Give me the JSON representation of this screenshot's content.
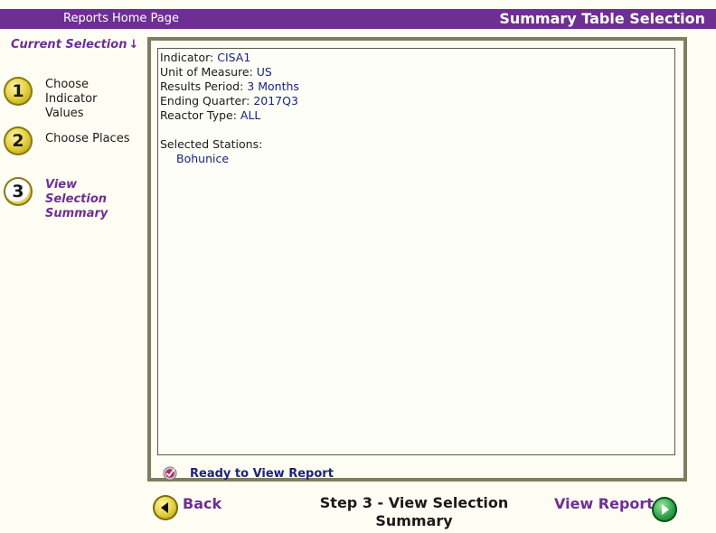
{
  "header": {
    "home_link": "Reports Home Page",
    "title": "Summary Table Selection"
  },
  "sidebar": {
    "current_selection_label": "Current Selection",
    "current_selection_icon": "arrow-down-icon",
    "steps": [
      {
        "number": "1",
        "label_lines": [
          "Choose",
          "Indicator",
          "Values"
        ],
        "label": "Choose Indicator Values",
        "current": false
      },
      {
        "number": "2",
        "label": "Choose Places",
        "current": false
      },
      {
        "number": "3",
        "label_lines": [
          "View",
          "Selection",
          "Summary"
        ],
        "label": "View Selection Summary",
        "current": true
      }
    ]
  },
  "summary": {
    "indicator_label": "Indicator:",
    "indicator_value": "CISA1",
    "unit_label": "Unit of Measure:",
    "unit_value": "US",
    "period_label": "Results Period:",
    "period_value": "3 Months",
    "quarter_label": "Ending Quarter:",
    "quarter_value": "2017Q3",
    "reactor_label": "Reactor Type:",
    "reactor_value": "ALL",
    "stations_label": "Selected Stations:",
    "stations": [
      "Bohunice"
    ]
  },
  "status": {
    "icon": "check-seal-icon",
    "text": "Ready to View Report"
  },
  "navigation": {
    "back_label": "Back",
    "back_icon": "arrow-left-circle-icon",
    "step_caption_line1": "Step 3 - View Selection",
    "step_caption_line2": "Summary",
    "view_report_label": "View Report",
    "view_report_icon": "arrow-right-circle-icon"
  },
  "colors": {
    "brand_purple": "#6e2f94",
    "value_navy": "#1a237e",
    "panel_border": "#7e7e5e",
    "background": "#fdfdf3"
  }
}
